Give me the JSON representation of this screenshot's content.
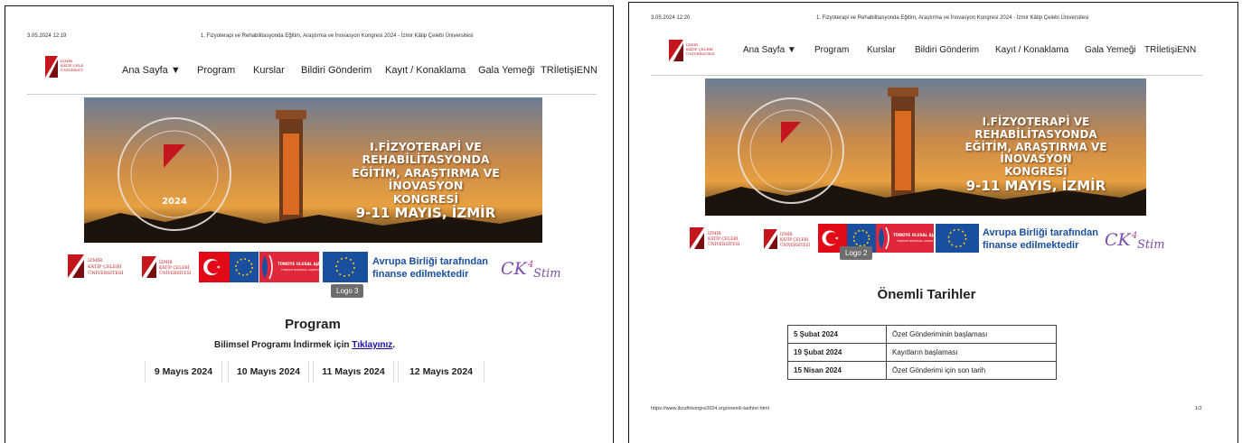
{
  "left_page": {
    "print_timestamp": "3.05.2024 12:19",
    "print_title": "1. Fizyoterapi ve Rehabilitasyonda Eğitim, Araştırma ve İnovasyon Kongresi 2024 - İzmir Kâtip Çelebi Üniversitesi",
    "nav": [
      "Ana Sayfa ▼",
      "Program",
      "Kurslar",
      "Bildiri Gönderim",
      "Kayıt / Konaklama",
      "Gala Yemeği",
      "TRİletişiENN"
    ],
    "banner_lines": [
      "I.FİZYOTERAPİ VE REHABİLİTASYONDA",
      "EĞİTİM, ARAŞTIRMA VE İNOVASYON",
      "KONGRESİ",
      "9-11 MAYIS, İZMİR"
    ],
    "seal_year": "2024",
    "eu_text": [
      "Avrupa Birliği tarafından",
      "finanse edilmektedir"
    ],
    "tooltip": "Logo 3",
    "section_title": "Program",
    "program_prefix": "Bilimsel Programı İndirmek için ",
    "program_link": "Tıklayınız",
    "program_suffix": ".",
    "day_tabs": [
      "9 Mayıs 2024",
      "10 Mayıs 2024",
      "11 Mayıs 2024",
      "12 Mayıs 2024"
    ]
  },
  "right_page": {
    "print_timestamp": "3.05.2024 12:20",
    "print_title": "1. Fizyoterapi ve Rehabilitasyonda Eğitim, Araştırma ve İnovasyon Kongresi 2024 - İzmir Kâtip Çelebi Üniversitesi",
    "nav": [
      "Ana Sayfa ▼",
      "Program",
      "Kurslar",
      "Bildiri Gönderim",
      "Kayıt / Konaklama",
      "Gala Yemeği",
      "TRİletişiENN"
    ],
    "banner_lines": [
      "I.FİZYOTERAPİ VE REHABİLİTASYONDA",
      "EĞİTİM, ARAŞTIRMA VE İNOVASYON",
      "KONGRESİ",
      "9-11 MAYIS, İZMİR"
    ],
    "eu_text": [
      "Avrupa Birliği tarafından",
      "finanse edilmektedir"
    ],
    "tooltip": "Logo 2",
    "section_title": "Önemli Tarihler",
    "dates": [
      {
        "date": "5 Şubat 2024",
        "event": "Özet Gönderiminin başlaması"
      },
      {
        "date": "19 Şubat 2024",
        "event": "Kayıtların başlaması"
      },
      {
        "date": "15 Nisan 2024",
        "event": "Özet Gönderimi için son tarih"
      }
    ],
    "footer_url": "https://www.ikcuftrkongre2024.org/onemli-tarihler.html",
    "footer_page": "1/2"
  },
  "colors": {
    "eu_blue": "#1a4fa0",
    "turkey_red": "#e30a17",
    "uni_red": "#c4161c",
    "link": "#1a0dab",
    "tooltip": "#6d6d6d"
  }
}
